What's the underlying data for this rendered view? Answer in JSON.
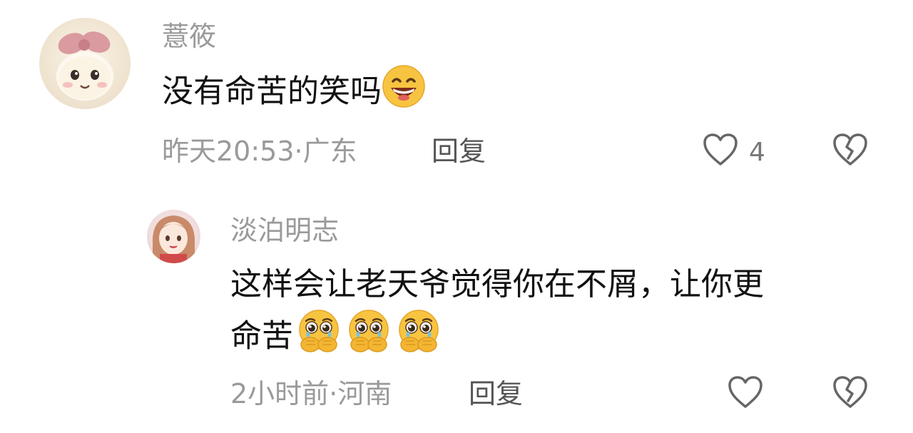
{
  "comment": {
    "username": "薏筱",
    "text": "没有命苦的笑吗",
    "emoji": "grinning-face-emoji",
    "time": "昨天20:53",
    "location": "广东",
    "meta_separator": "·",
    "reply_label": "回复",
    "like_count": "4"
  },
  "reply_comment": {
    "username": "淡泊明志",
    "text_line1": "这样会让老天爷觉得你在不屑，让你更",
    "text_line2": "命苦",
    "emoji": "holding-back-tears-emoji",
    "emoji_count": 3,
    "time": "2小时前",
    "location": "河南",
    "meta_separator": "·",
    "reply_label": "回复"
  },
  "icons": {
    "like": "heart-outline-icon",
    "dislike": "broken-heart-icon"
  },
  "colors": {
    "username": "#9a9a9a",
    "text": "#111111",
    "meta": "#9a9a9a",
    "reply": "#555555",
    "icon": "#666666",
    "emoji_face": "#f7c441"
  }
}
